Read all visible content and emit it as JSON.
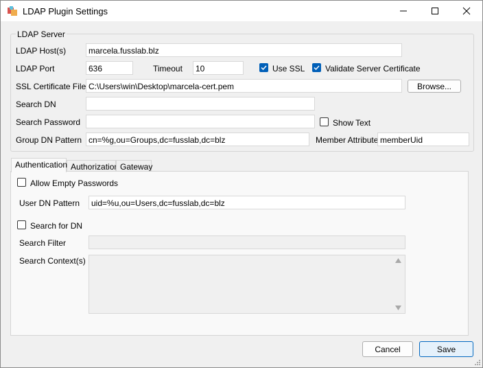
{
  "window": {
    "title": "LDAP Plugin Settings"
  },
  "server": {
    "group_label": "LDAP Server",
    "host_label": "LDAP Host(s)",
    "host_value": "marcela.fusslab.blz",
    "port_label": "LDAP Port",
    "port_value": "636",
    "timeout_label": "Timeout",
    "timeout_value": "10",
    "use_ssl_label": "Use SSL",
    "use_ssl_checked": true,
    "validate_cert_label": "Validate Server Certificate",
    "validate_cert_checked": true,
    "ssl_cert_label": "SSL Certificate File",
    "ssl_cert_value": "C:\\Users\\win\\Desktop\\marcela-cert.pem",
    "browse_label": "Browse...",
    "search_dn_label": "Search DN",
    "search_dn_value": "",
    "search_password_label": "Search Password",
    "search_password_value": "",
    "show_text_label": "Show Text",
    "show_text_checked": false,
    "group_dn_label": "Group DN Pattern",
    "group_dn_value": "cn=%g,ou=Groups,dc=fusslab,dc=blz",
    "member_attr_label": "Member Attribute",
    "member_attr_value": "memberUid"
  },
  "tabs": [
    {
      "label": "Authentication",
      "active": true
    },
    {
      "label": "Authorization",
      "active": false
    },
    {
      "label": "Gateway",
      "active": false
    }
  ],
  "auth": {
    "allow_empty_label": "Allow Empty Passwords",
    "allow_empty_checked": false,
    "user_dn_label": "User DN Pattern",
    "user_dn_value": "uid=%u,ou=Users,dc=fusslab,dc=blz",
    "search_for_dn_label": "Search for DN",
    "search_for_dn_checked": false,
    "search_filter_label": "Search Filter",
    "search_filter_value": "",
    "search_context_label": "Search Context(s)"
  },
  "footer": {
    "cancel_label": "Cancel",
    "save_label": "Save"
  },
  "colors": {
    "accent": "#005fb8",
    "window_bg": "#f0f0f0"
  }
}
